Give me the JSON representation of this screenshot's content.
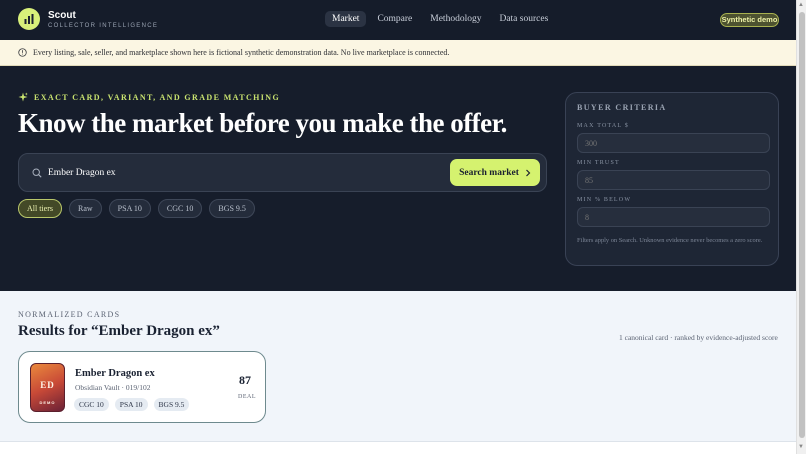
{
  "brand": {
    "name": "Scout",
    "tagline": "COLLECTOR INTELLIGENCE",
    "icon": "bar-chart-icon"
  },
  "nav": [
    {
      "label": "Market",
      "active": true
    },
    {
      "label": "Compare",
      "active": false
    },
    {
      "label": "Methodology",
      "active": false
    },
    {
      "label": "Data sources",
      "active": false
    }
  ],
  "badge": "Synthetic demo",
  "notice": {
    "icon": "info-circle-icon",
    "text": "Every listing, sale, seller, and marketplace shown here is fictional synthetic demonstration data. No live marketplace is connected."
  },
  "hero": {
    "eyebrow_icon": "sparkle-icon",
    "eyebrow": "EXACT CARD, VARIANT, AND GRADE MATCHING",
    "headline": "Know the market before you make the offer.",
    "search": {
      "value": "Ember Dragon ex",
      "button_label": "Search market"
    },
    "chips": [
      {
        "label": "All tiers",
        "active": true
      },
      {
        "label": "Raw",
        "active": false
      },
      {
        "label": "PSA 10",
        "active": false
      },
      {
        "label": "CGC 10",
        "active": false
      },
      {
        "label": "BGS 9.5",
        "active": false
      }
    ]
  },
  "criteria": {
    "title": "BUYER CRITERIA",
    "fields": [
      {
        "label": "MAX TOTAL $",
        "placeholder": "300"
      },
      {
        "label": "MIN TRUST",
        "placeholder": "85"
      },
      {
        "label": "MIN % BELOW",
        "placeholder": "8"
      }
    ],
    "note": "Filters apply on Search. Unknown evidence never becomes a zero score."
  },
  "results": {
    "eyebrow": "NORMALIZED CARDS",
    "title": "Results for “Ember Dragon ex”",
    "meta": "1 canonical card · ranked by evidence-adjusted score",
    "cards": [
      {
        "name": "Ember Dragon ex",
        "set": "Obsidian Vault · 019/102",
        "thumb_initials": "ED",
        "thumb_tag": "DEMO",
        "grades": [
          "CGC 10",
          "PSA 10",
          "BGS 9.5"
        ],
        "score": "87",
        "score_label": "DEAL"
      }
    ]
  },
  "colors": {
    "accent": "#d5f26f",
    "hero_bg": "#161d2b",
    "page_bg": "#f1f5fa",
    "notice_bg": "#fbf6e3"
  }
}
